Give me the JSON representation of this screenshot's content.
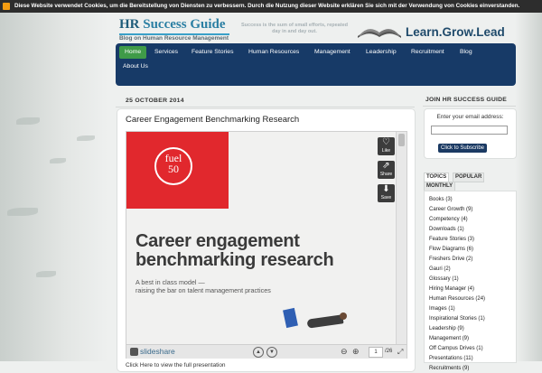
{
  "cookie_bar": {
    "text": "Diese Website verwendet Cookies, um die Bereitstellung von Diensten zu verbessern. Durch die Nutzung dieser Website erklären Sie sich mit der Verwendung von Cookies einverstanden."
  },
  "header": {
    "logo_title_part1": "HR ",
    "logo_title_part2": "Success Guide",
    "logo_subtitle": "Blog on Human Resource Management",
    "tagline": "Success is the sum of small efforts, repeated day in and day out.",
    "slogan": "Learn.Grow.Lead"
  },
  "nav": {
    "items": [
      "Home",
      "Services",
      "Feature Stories",
      "Human Resources",
      "Management",
      "Leadership",
      "Recruitment",
      "Blog",
      "About Us"
    ],
    "active": "Home"
  },
  "post": {
    "date": "25 OCTOBER 2014",
    "title": "Career Engagement Benchmarking Research",
    "bottom_text": "Click Here to view the full presentation"
  },
  "slide": {
    "logo_text_line1": "fuel",
    "logo_text_line2": "50",
    "heading_line1": "Career engagement",
    "heading_line2": "benchmarking research",
    "subtext_line1": "A best in class model —",
    "subtext_line2": "raising the bar on talent management practices"
  },
  "embed_controls": {
    "like_label": "Like",
    "share_label": "Share",
    "save_label": "Save",
    "slideshare_label": "slideshare",
    "current_page": "1",
    "total_pages": "/26"
  },
  "sidebar": {
    "join_title": "JOIN HR SUCCESS GUIDE",
    "email_label": "Enter your email address:",
    "email_value": "",
    "subscribe_label": "Click to Subscribe",
    "tabs": [
      "TOPICS",
      "POPULAR",
      "MONTHLY"
    ],
    "active_tab": "TOPICS",
    "topics": [
      "Books (3)",
      "Career Growth (9)",
      "Competency (4)",
      "Downloads (1)",
      "Feature Stories (3)",
      "Flow Diagrams (6)",
      "Freshers Drive (2)",
      "Gauri (2)",
      "Glossary (1)",
      "Hiring Manager (4)",
      "Human Resources (24)",
      "Images (1)",
      "Inspirational Stories (1)",
      "Leadership (9)",
      "Management (9)",
      "Off Campus Drives (1)",
      "Presentations (11)",
      "Recruitments (9)"
    ]
  },
  "colors": {
    "nav_bg": "#173a67",
    "nav_active": "#3f9b48",
    "brand_red": "#e1282d",
    "cookie_bar_bg": "#2d2d2d"
  }
}
